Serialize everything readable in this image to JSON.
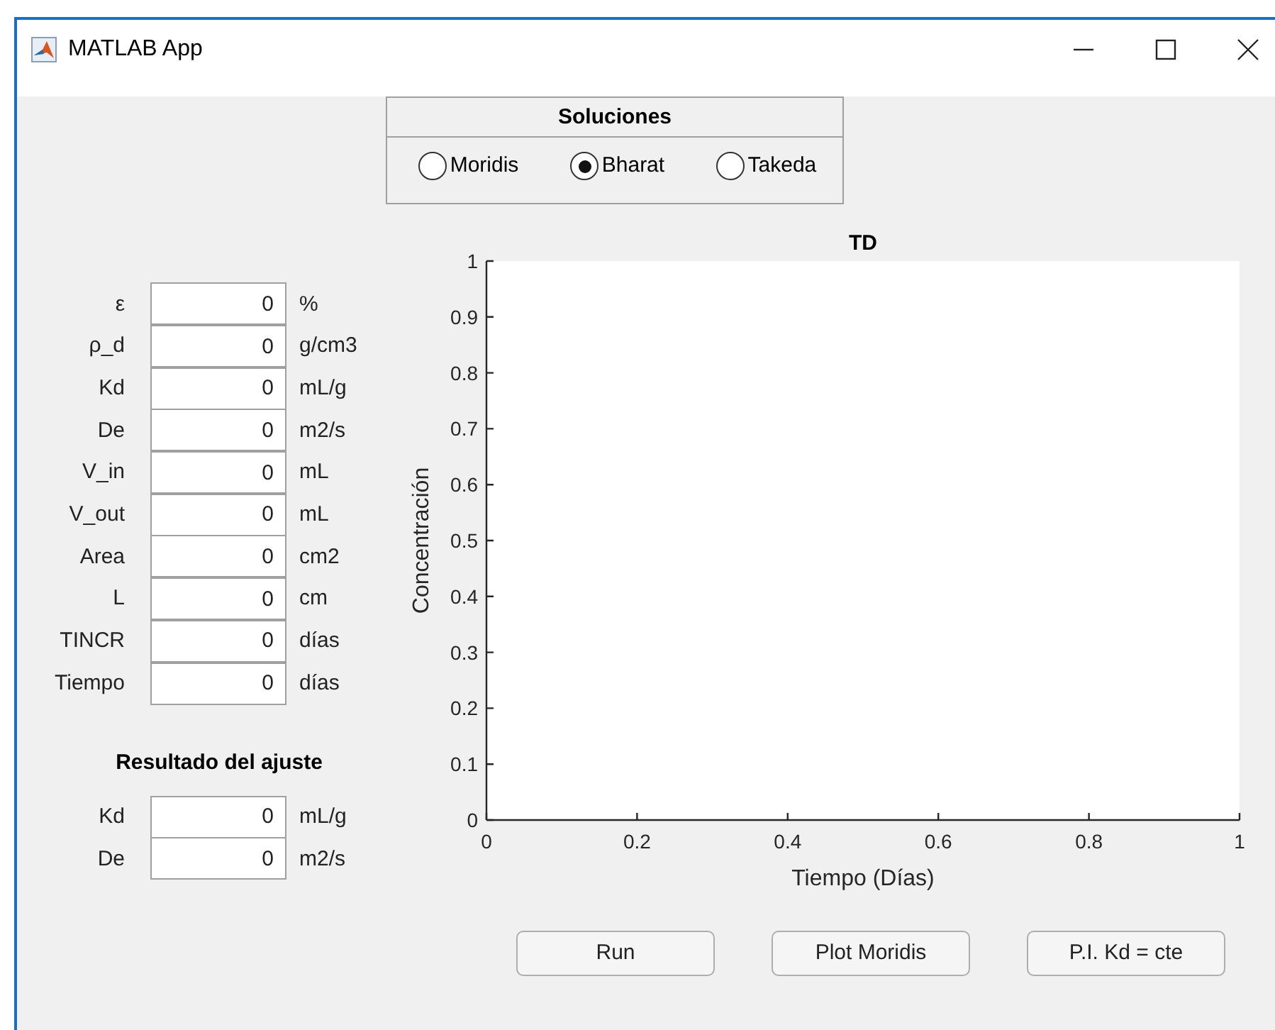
{
  "window": {
    "title": "MATLAB App"
  },
  "solutions_panel": {
    "title": "Soluciones",
    "options": [
      {
        "label": "Moridis",
        "selected": false
      },
      {
        "label": "Bharat",
        "selected": true
      },
      {
        "label": "Takeda",
        "selected": false
      }
    ]
  },
  "parameters": [
    {
      "label": "ε",
      "value": "0",
      "unit": "%"
    },
    {
      "label": "ρ_d",
      "value": "0",
      "unit": "g/cm3"
    },
    {
      "label": "Kd",
      "value": "0",
      "unit": "mL/g"
    },
    {
      "label": "De",
      "value": "0",
      "unit": "m2/s"
    },
    {
      "label": "V_in",
      "value": "0",
      "unit": "mL"
    },
    {
      "label": "V_out",
      "value": "0",
      "unit": "mL"
    },
    {
      "label": "Area",
      "value": "0",
      "unit": "cm2"
    },
    {
      "label": "L",
      "value": "0",
      "unit": "cm"
    },
    {
      "label": "TINCR",
      "value": "0",
      "unit": "días"
    },
    {
      "label": "Tiempo",
      "value": "0",
      "unit": "días"
    }
  ],
  "fit_result": {
    "title": "Resultado del ajuste",
    "fields": [
      {
        "label": "Kd",
        "value": "0",
        "unit": "mL/g"
      },
      {
        "label": "De",
        "value": "0",
        "unit": "m2/s"
      }
    ]
  },
  "plot": {
    "chart_data": {
      "type": "line",
      "title": "TD",
      "xlabel": "Tiempo (Días)",
      "ylabel": "Concentración",
      "xlim": [
        0,
        1
      ],
      "ylim": [
        0,
        1
      ],
      "xticks": [
        0,
        0.2,
        0.4,
        0.6,
        0.8,
        1
      ],
      "yticks": [
        0,
        0.1,
        0.2,
        0.3,
        0.4,
        0.5,
        0.6,
        0.7,
        0.8,
        0.9,
        1
      ]
    }
  },
  "buttons": [
    {
      "label": "Run"
    },
    {
      "label": "Plot Moridis"
    },
    {
      "label": "P.I. Kd = cte"
    }
  ]
}
